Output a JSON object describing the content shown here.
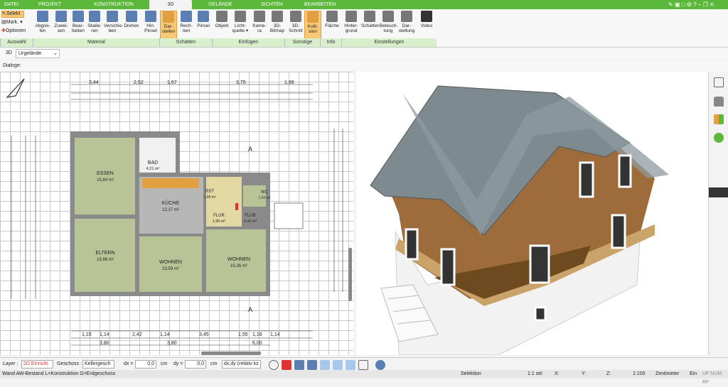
{
  "tabs": [
    {
      "label": "DATEI"
    },
    {
      "label": "PROJEKT"
    },
    {
      "label": "KONSTRUKTION"
    },
    {
      "label": "3D"
    },
    {
      "label": "GELÄNDE"
    },
    {
      "label": "SICHTEN"
    },
    {
      "label": "BEARBEITEN"
    }
  ],
  "ribbon": {
    "auswahl": {
      "select": "Selekt",
      "mark": "Mark.",
      "options": "Optionen"
    },
    "buttons": [
      {
        "label": "Abgrei-\nfen",
        "color": "#5a7fb0"
      },
      {
        "label": "Zuwei-\nsen",
        "color": "#5a7fb0"
      },
      {
        "label": "Bear-\nbeiten",
        "color": "#5a7fb0"
      },
      {
        "label": "Skalie-\nren",
        "color": "#5a7fb0"
      },
      {
        "label": "Verschie-\nben",
        "color": "#5a7fb0"
      },
      {
        "label": "Drehen",
        "color": "#5a7fb0"
      },
      {
        "label": "Hin.\nPinsel",
        "color": "#5a7fb0"
      },
      {
        "label": "Dar-\nstellen",
        "color": "#e0a040"
      },
      {
        "label": "Rech-\nnen",
        "color": "#5a7fb0"
      },
      {
        "label": "Pinsel",
        "color": "#5a7fb0"
      },
      {
        "label": "Objekt",
        "color": "#777"
      },
      {
        "label": "Licht-\nquelle ▾",
        "color": "#777"
      },
      {
        "label": "Kame-\nra",
        "color": "#777"
      },
      {
        "label": "3D-\nBitmap",
        "color": "#777"
      },
      {
        "label": "3D-\nSchnitt",
        "color": "#777"
      },
      {
        "label": "Kolli-\nsion",
        "color": "#e0a040"
      },
      {
        "label": "Fläche",
        "color": "#777"
      },
      {
        "label": "Hinter-\ngrund",
        "color": "#777"
      },
      {
        "label": "Schatten",
        "color": "#777"
      },
      {
        "label": "Beleuch-\ntung",
        "color": "#777"
      },
      {
        "label": "Dar-\nstellung",
        "color": "#777"
      },
      {
        "label": "Video",
        "color": "#333"
      }
    ],
    "groups": [
      "Auswahl",
      "Material",
      "Schatten",
      "Einfügen",
      "Sonstige",
      "Info",
      "Einstellungen"
    ]
  },
  "view_toolbar": {
    "mode": "3D",
    "terrain": "Urgelände"
  },
  "dialog_label": "Dialoge:",
  "plan": {
    "rooms": [
      {
        "name": "ESSEN",
        "area": "15,84 m²"
      },
      {
        "name": "BAD",
        "area": "4,21 m²"
      },
      {
        "name": "KÜCHE",
        "area": "12,17 m²"
      },
      {
        "name": "ELTERN",
        "area": "15,68 m²"
      },
      {
        "name": "WOHNEN",
        "area": "13,59 m²"
      },
      {
        "name": "WOHNEN",
        "area": "15,36 m²"
      },
      {
        "name": "FLUR",
        "area": "1,96 m²"
      },
      {
        "name": "FLUR",
        "area": "3,43 m²"
      },
      {
        "name": "WC",
        "area": "1,52 m²"
      },
      {
        "name": "RST",
        "area": "1,08 m²"
      }
    ],
    "dims_top": [
      "3,44",
      "2,52",
      "1,67",
      "3,75",
      "1,66"
    ],
    "dims_bottom": [
      "1,15",
      "1,14",
      "2,42",
      "1,14",
      "3,45",
      "1,55",
      "1,16",
      "1,14",
      "3,80",
      "3,80",
      "6,00"
    ],
    "section_label": "A"
  },
  "bottom": {
    "layer_label": "Layer :",
    "layer_value": "2D Einricht",
    "floor_label": "Geschoss :",
    "floor_value": "Kellergesch",
    "dx_label": "dx =",
    "dx_value": "0,0",
    "dy_label": "dy =",
    "dy_value": "0,0",
    "unit": "cm",
    "mode": "dx,dy (relativ kz"
  },
  "status": {
    "text": "Wand AW-Bestand L=Konstruktion G=Erdgeschoss",
    "mode": "Selektion",
    "sel": "1:1 sel",
    "x": "X:",
    "y": "Y:",
    "z": "Z:",
    "scale": "1:100",
    "unit": "Zentimeter",
    "ein": "Ein",
    "flags": "UF NUM RF"
  }
}
